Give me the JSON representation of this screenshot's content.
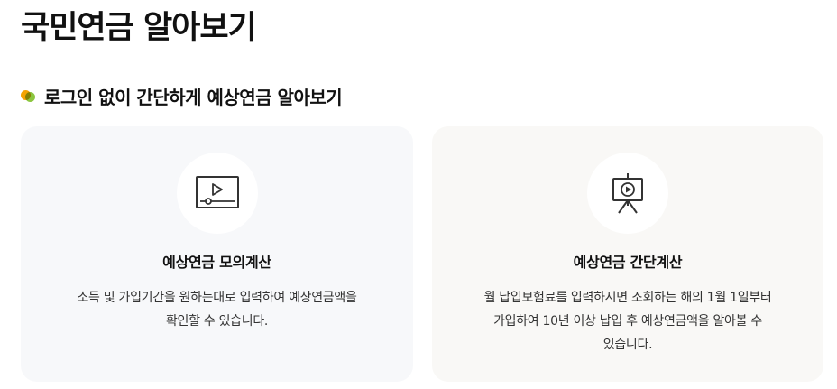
{
  "page_title": "국민연금 알아보기",
  "section": {
    "heading": "로그인 없이 간단하게 예상연금 알아보기",
    "bullet_colors": [
      "#f4a300",
      "#8cc63f"
    ]
  },
  "cards": [
    {
      "icon": "video-player-icon",
      "title": "예상연금 모의계산",
      "description_lines": [
        "소득 및 가입기간을 원하는대로 입력하여 예상연금액을",
        "확인할 수 있습니다."
      ]
    },
    {
      "icon": "presentation-board-icon",
      "title": "예상연금 간단계산",
      "description_lines": [
        "월 납입보험료를 입력하시면 조회하는 해의 1월 1일부터",
        "가입하여 10년 이상 납입 후 예상연금액을 알아볼 수",
        "있습니다."
      ]
    }
  ]
}
